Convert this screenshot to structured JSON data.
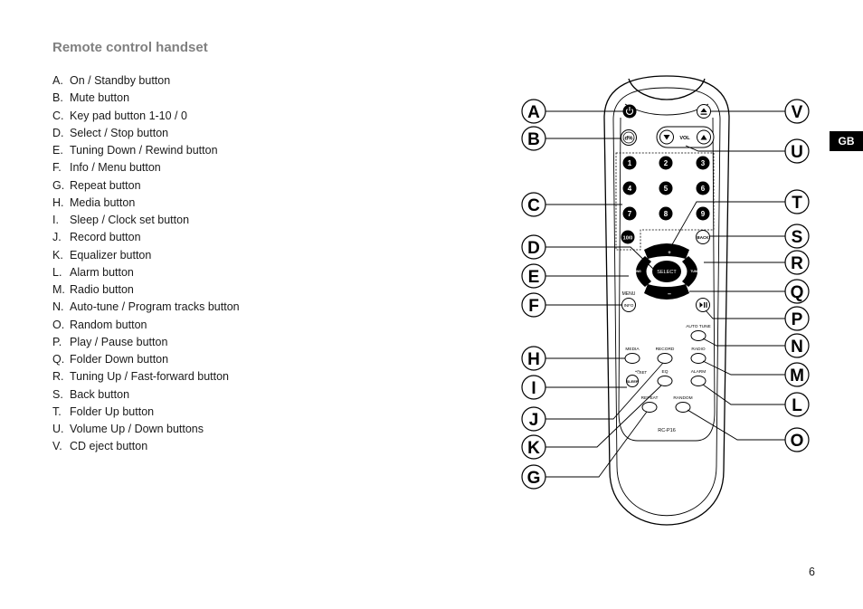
{
  "page": {
    "title": "Remote control handset",
    "language_tab": "GB",
    "page_number": "6"
  },
  "legend": [
    {
      "letter": "A.",
      "text": "On / Standby button"
    },
    {
      "letter": "B.",
      "text": "Mute button"
    },
    {
      "letter": "C.",
      "text": "Key pad button 1-10 / 0"
    },
    {
      "letter": "D.",
      "text": "Select / Stop button"
    },
    {
      "letter": "E.",
      "text": "Tuning Down / Rewind button"
    },
    {
      "letter": "F.",
      "text": "Info / Menu button"
    },
    {
      "letter": "G.",
      "text": "Repeat button"
    },
    {
      "letter": "H.",
      "text": "Media button"
    },
    {
      "letter": "I.",
      "text": "Sleep / Clock set button"
    },
    {
      "letter": "J.",
      "text": "Record button"
    },
    {
      "letter": "K.",
      "text": "Equalizer button"
    },
    {
      "letter": "L.",
      "text": "Alarm button"
    },
    {
      "letter": "M.",
      "text": "Radio button"
    },
    {
      "letter": "N.",
      "text": "Auto-tune / Program tracks button"
    },
    {
      "letter": "O.",
      "text": "Random button"
    },
    {
      "letter": "P.",
      "text": "Play / Pause button"
    },
    {
      "letter": "Q.",
      "text": "Folder Down button"
    },
    {
      "letter": "R.",
      "text": "Tuning Up / Fast-forward button"
    },
    {
      "letter": "S.",
      "text": "Back button"
    },
    {
      "letter": "T.",
      "text": "Folder Up button"
    },
    {
      "letter": "U.",
      "text": "Volume Up / Down buttons"
    },
    {
      "letter": "V.",
      "text": "CD eject button"
    }
  ],
  "callouts": {
    "left": [
      "A",
      "B",
      "C",
      "D",
      "E",
      "F",
      "H",
      "I",
      "J",
      "K",
      "G"
    ],
    "right": [
      "V",
      "U",
      "T",
      "S",
      "R",
      "Q",
      "P",
      "N",
      "M",
      "L",
      "O"
    ]
  },
  "remote": {
    "model": "RC-P16",
    "vol_label": "VOL",
    "keypad": [
      "1",
      "2",
      "3",
      "4",
      "5",
      "6",
      "7",
      "8",
      "9"
    ],
    "key_10_0": "10/0",
    "back_label": "BACK",
    "select_label": "SELECT",
    "tuning_label": "TUNING",
    "menu_label": "MENU",
    "info_label": "INFO",
    "auto_tune_label": "AUTO TUNE",
    "media_label": "MEDIA",
    "record_label": "RECORD",
    "radio_label": "RADIO",
    "set_label": "SET",
    "sleep_label": "SLEEP",
    "eq_label": "EQ",
    "alarm_label": "ALARM",
    "repeat_label": "REPEAT",
    "random_label": "RANDOM",
    "folder_up_label": "+",
    "folder_down_label": "–"
  }
}
